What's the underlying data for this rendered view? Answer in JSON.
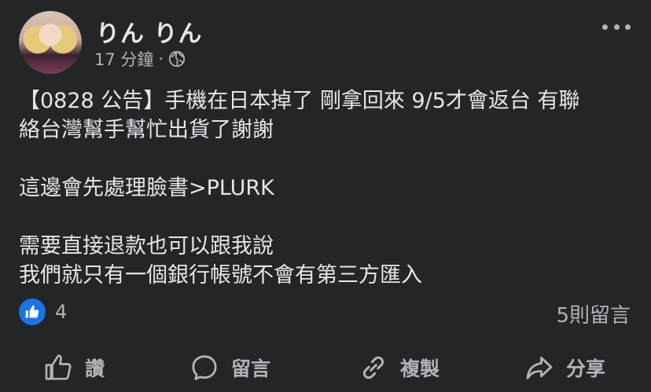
{
  "post": {
    "author": "りん りん",
    "time": "17 分鐘",
    "separator": "·",
    "audience_icon": "globe-icon",
    "more_icon": "more-options-icon",
    "body": {
      "line1": "【0828 公告】手機在日本掉了 剛拿回來 9/5才會返台 有聯",
      "line2": "絡台灣幫手幫忙出貨了謝謝",
      "line3": "這邊會先處理臉書>PLURK",
      "line4": "需要直接退款也可以跟我說",
      "line5": "我們就只有一個銀行帳號不會有第三方匯入"
    },
    "reactions": {
      "icon": "like-icon",
      "count": "4"
    },
    "comments_count": "5則留言",
    "actions": {
      "like": {
        "label": "讚",
        "icon": "thumbs-up-icon"
      },
      "comment": {
        "label": "留言",
        "icon": "comment-icon"
      },
      "copy": {
        "label": "複製",
        "icon": "link-icon"
      },
      "share": {
        "label": "分享",
        "icon": "share-icon"
      }
    }
  },
  "colors": {
    "background": "#242527",
    "primary_text": "#e4e6eb",
    "secondary_text": "#b0b3b8",
    "like_blue": "#1b74e4"
  }
}
